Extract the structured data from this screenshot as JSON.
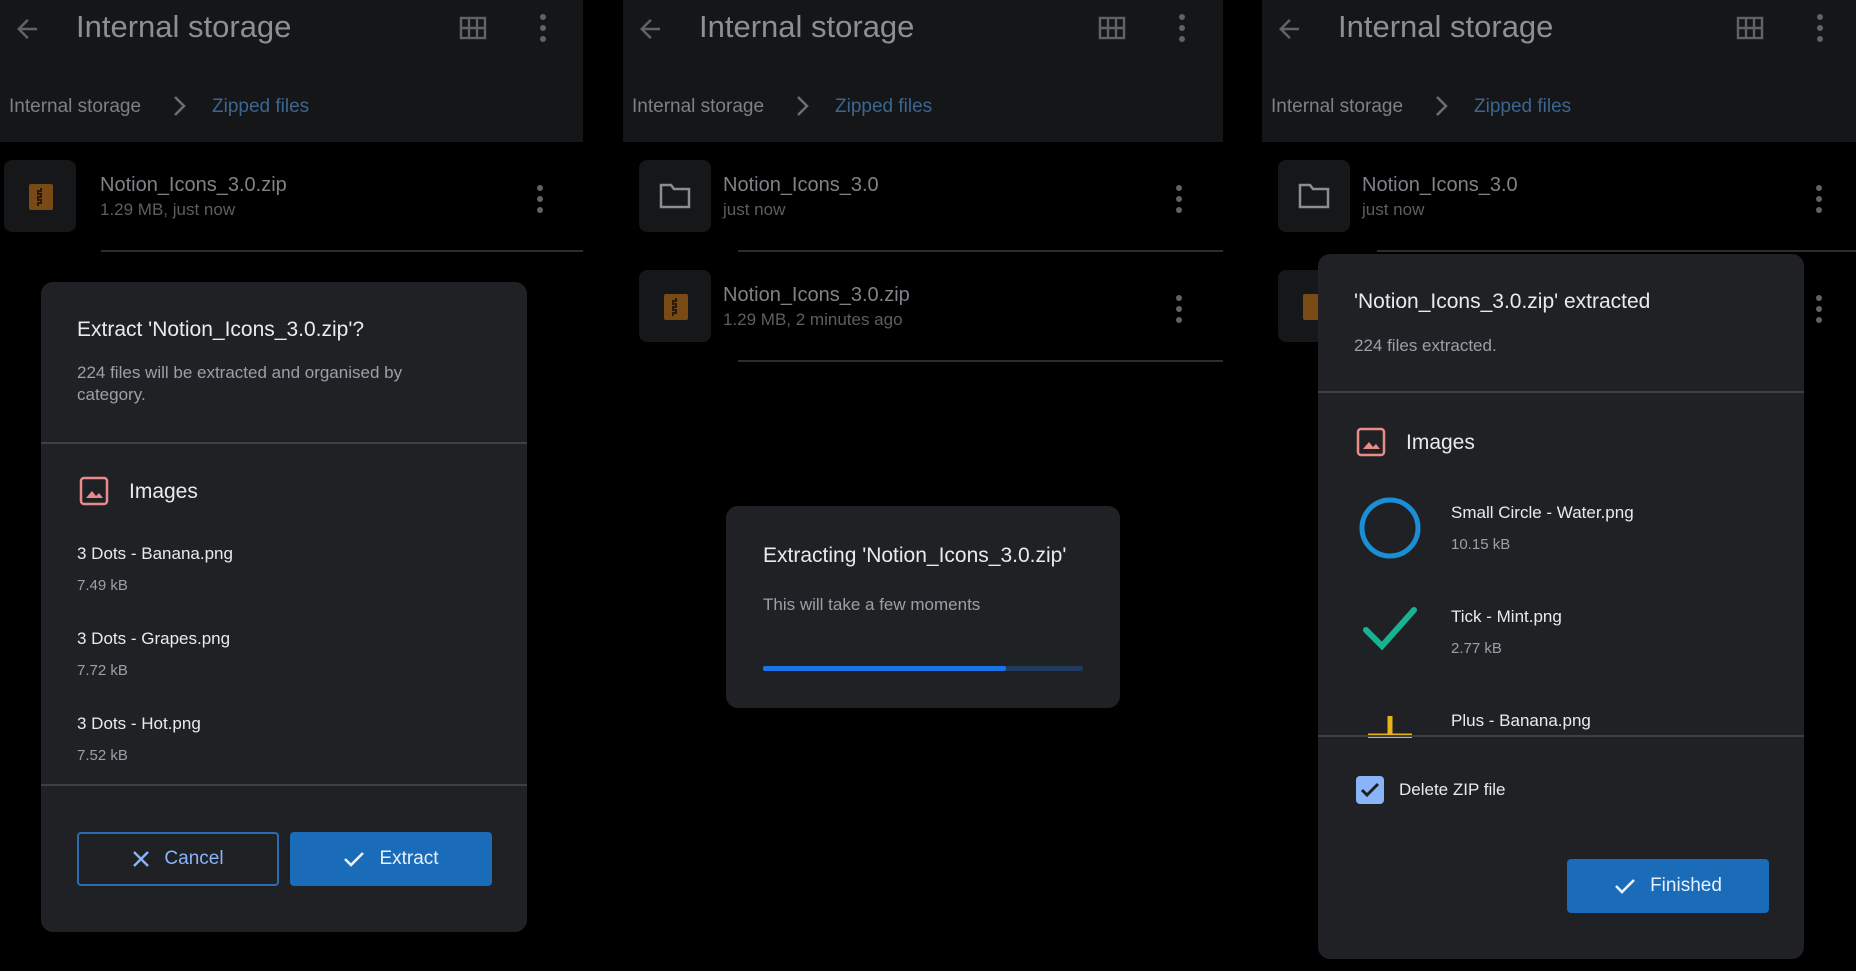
{
  "app": {
    "title": "Internal storage"
  },
  "breadcrumb": {
    "root": "Internal storage",
    "current": "Zipped files"
  },
  "panel1": {
    "files": [
      {
        "name": "Notion_Icons_3.0.zip",
        "meta": "1.29 MB, just now"
      }
    ],
    "dialog": {
      "title": "Extract 'Notion_Icons_3.0.zip'?",
      "subtitle_line1": "224 files will be extracted and organised by",
      "subtitle_line2": "category.",
      "section": "Images",
      "items": [
        {
          "name": "3 Dots - Banana.png",
          "size": "7.49 kB"
        },
        {
          "name": "3 Dots - Grapes.png",
          "size": "7.72 kB"
        },
        {
          "name": "3 Dots - Hot.png",
          "size": "7.52 kB"
        }
      ],
      "cancel_label": "Cancel",
      "extract_label": "Extract"
    }
  },
  "panel2": {
    "files": [
      {
        "name": "Notion_Icons_3.0",
        "meta": "just now"
      },
      {
        "name": "Notion_Icons_3.0.zip",
        "meta": "1.29 MB, 2 minutes ago"
      }
    ],
    "dialog": {
      "title": "Extracting 'Notion_Icons_3.0.zip'",
      "subtitle": "This will take a few moments",
      "progress": 0.76
    }
  },
  "panel3": {
    "files": [
      {
        "name": "Notion_Icons_3.0",
        "meta": "just now"
      }
    ],
    "dialog": {
      "title": "'Notion_Icons_3.0.zip' extracted",
      "subtitle": "224 files extracted.",
      "section": "Images",
      "items": [
        {
          "name": "Small Circle - Water.png",
          "size": "10.15 kB",
          "icon": "circle-icon",
          "color": "#1b8fd6"
        },
        {
          "name": "Tick - Mint.png",
          "size": "2.77 kB",
          "icon": "tick-icon",
          "color": "#19b394"
        },
        {
          "name": "Plus - Banana.png",
          "size": "",
          "icon": "plus-icon",
          "color": "#e8b21a"
        }
      ],
      "delete_zip_label": "Delete ZIP file",
      "delete_zip_checked": true,
      "finished_label": "Finished"
    }
  },
  "colors": {
    "accent": "#1a6bb8",
    "zip_icon": "#d27a1f",
    "image_icon": "#e88b8b"
  }
}
